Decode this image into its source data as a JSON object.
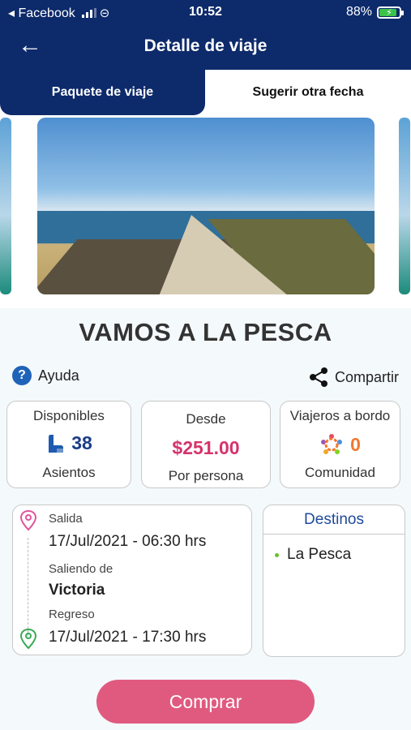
{
  "status_bar": {
    "carrier": "◂ Facebook",
    "time": "10:52",
    "battery": "88%",
    "battery_level": 0.88,
    "icons": [
      "signal-icon",
      "link-icon",
      "battery-icon"
    ]
  },
  "app_bar": {
    "title": "Detalle de viaje",
    "back_icon": "arrow-left-icon"
  },
  "tabs": [
    {
      "label": "Paquete de viaje",
      "active": true
    },
    {
      "label": "Sugerir otra fecha",
      "active": false
    }
  ],
  "trip": {
    "name": "VAMOS A LA PESCA"
  },
  "actions": {
    "help": "Ayuda",
    "share": "Compartir"
  },
  "stats": {
    "available": {
      "title": "Disponibles",
      "value": "38",
      "caption": "Asientos",
      "icon": "seat-icon"
    },
    "price": {
      "title": "Desde",
      "value": "$251.00",
      "caption": "Por persona"
    },
    "travelers": {
      "title": "Viajeros a bordo",
      "value": "0",
      "caption": "Comunidad",
      "icon": "community-icon"
    }
  },
  "itinerary": {
    "departure_label": "Salida",
    "departure_value": "17/Jul/2021 - 06:30 hrs",
    "from_label": "Saliendo de",
    "from_value": "Victoria",
    "return_label": "Regreso",
    "return_value": "17/Jul/2021 - 17:30 hrs"
  },
  "destinations": {
    "title": "Destinos",
    "items": [
      "La Pesca"
    ]
  },
  "buy_button": "Comprar",
  "colors": {
    "primary": "#0d2a6b",
    "price": "#d6336c",
    "accent_orange": "#f07830",
    "buy": "#e05a7f",
    "destination_dot": "#6bbf2c"
  }
}
